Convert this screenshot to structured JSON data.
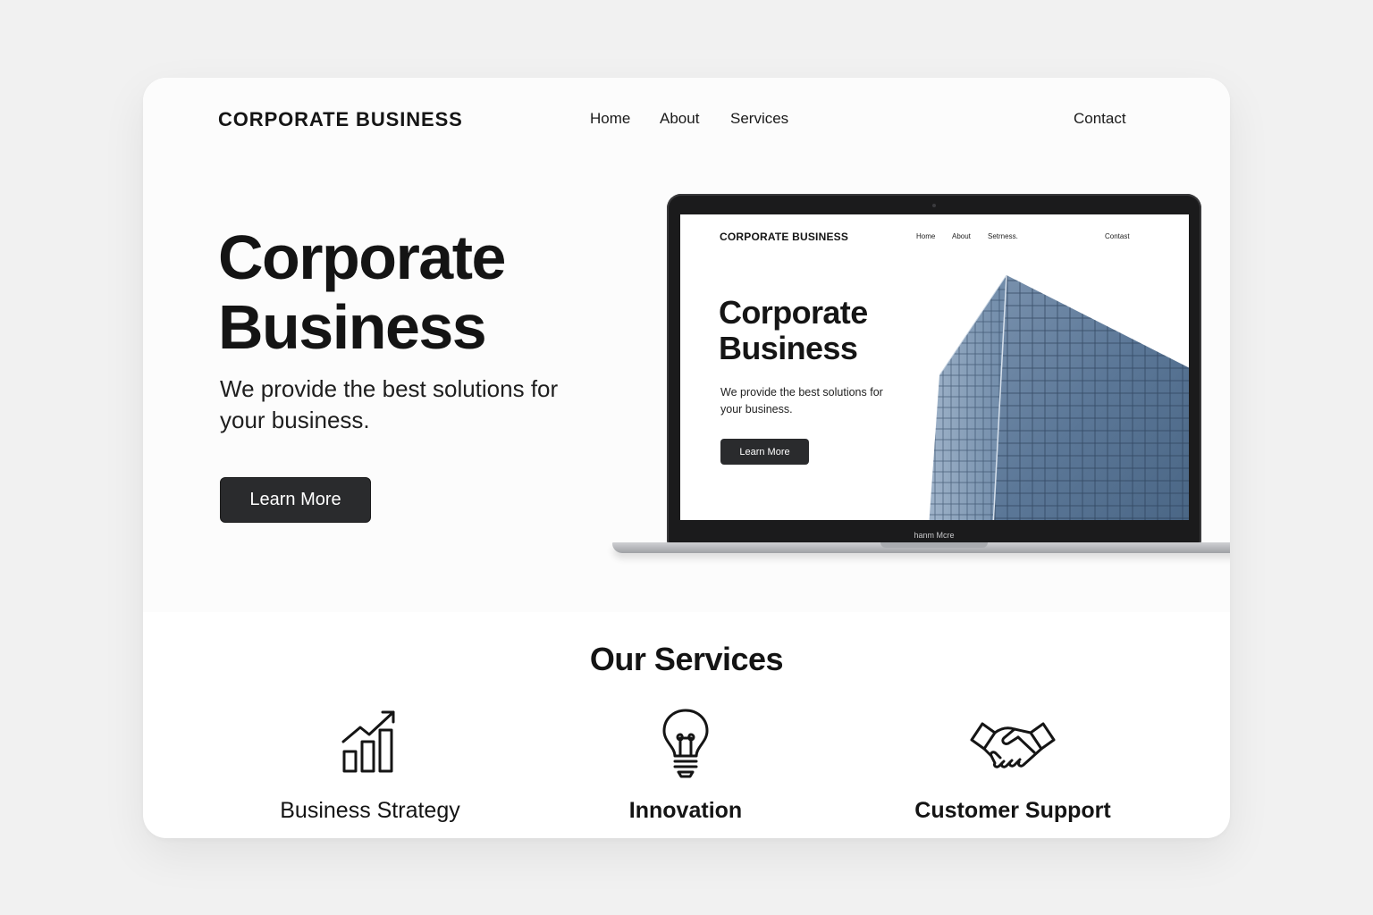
{
  "header": {
    "brand": "CORPORATE BUSINESS",
    "nav": {
      "home": "Home",
      "about": "About",
      "services": "Services",
      "contact": "Contact"
    }
  },
  "hero": {
    "title_line1": "Corporate",
    "title_line2": "Business",
    "subtitle": "We provide the best solutions for your business.",
    "cta_label": "Learn More"
  },
  "laptop_preview": {
    "brand": "CORPORATE BUSINESS",
    "nav": {
      "home": "Home",
      "about": "About",
      "services": "Setrness.",
      "contact": "Contast"
    },
    "title_line1": "Corporate",
    "title_line2": "Business",
    "subtitle": "We provide the best solutions for your business.",
    "cta_label": "Learn More",
    "base_label": "hanm Mcre"
  },
  "services": {
    "title": "Our Services",
    "items": [
      {
        "label": "Business Strategy",
        "icon": "bar-chart-growth-icon"
      },
      {
        "label": "Innovation",
        "icon": "lightbulb-icon"
      },
      {
        "label": "Customer Support",
        "icon": "handshake-icon"
      }
    ]
  },
  "colors": {
    "page_background": "#f1f1f1",
    "card_background": "#ffffff",
    "button_background": "#2a2b2d",
    "text": "#141414",
    "building_glass": "#5a7898"
  }
}
